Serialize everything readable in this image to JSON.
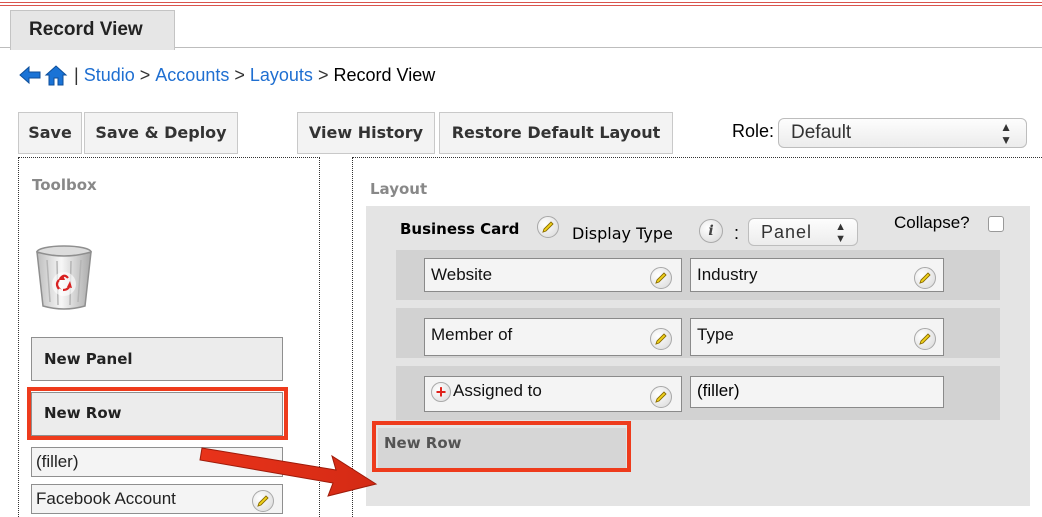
{
  "tab": {
    "label": "Record View"
  },
  "breadcrumb": {
    "sep1": "|",
    "studio": "Studio",
    "arrow1": ">",
    "accounts": "Accounts",
    "arrow2": ">",
    "layouts": "Layouts",
    "arrow3": ">",
    "current": "Record View"
  },
  "toolbar": {
    "save": "Save",
    "save_deploy": "Save & Deploy",
    "view_history": "View History",
    "restore": "Restore Default Layout",
    "role_label": "Role:",
    "role_value": "Default"
  },
  "toolbox": {
    "title": "Toolbox",
    "new_panel": "New Panel",
    "new_row": "New Row",
    "filler": "(filler)",
    "facebook": "Facebook Account"
  },
  "layout": {
    "title": "Layout",
    "panel_name": "Business Card",
    "display_type_label": "Display Type",
    "colon": ":",
    "display_type_value": "Panel",
    "collapse_label": "Collapse?",
    "rows": [
      {
        "left": "Website",
        "right": "Industry"
      },
      {
        "left": "Member of",
        "right": "Type"
      },
      {
        "left": "Assigned to",
        "right": "(filler)"
      }
    ],
    "new_row_drop": "New Row"
  },
  "colors": {
    "highlight": "#ee3b1c",
    "link": "#1f6fd1",
    "arrow": "#e8331a"
  }
}
